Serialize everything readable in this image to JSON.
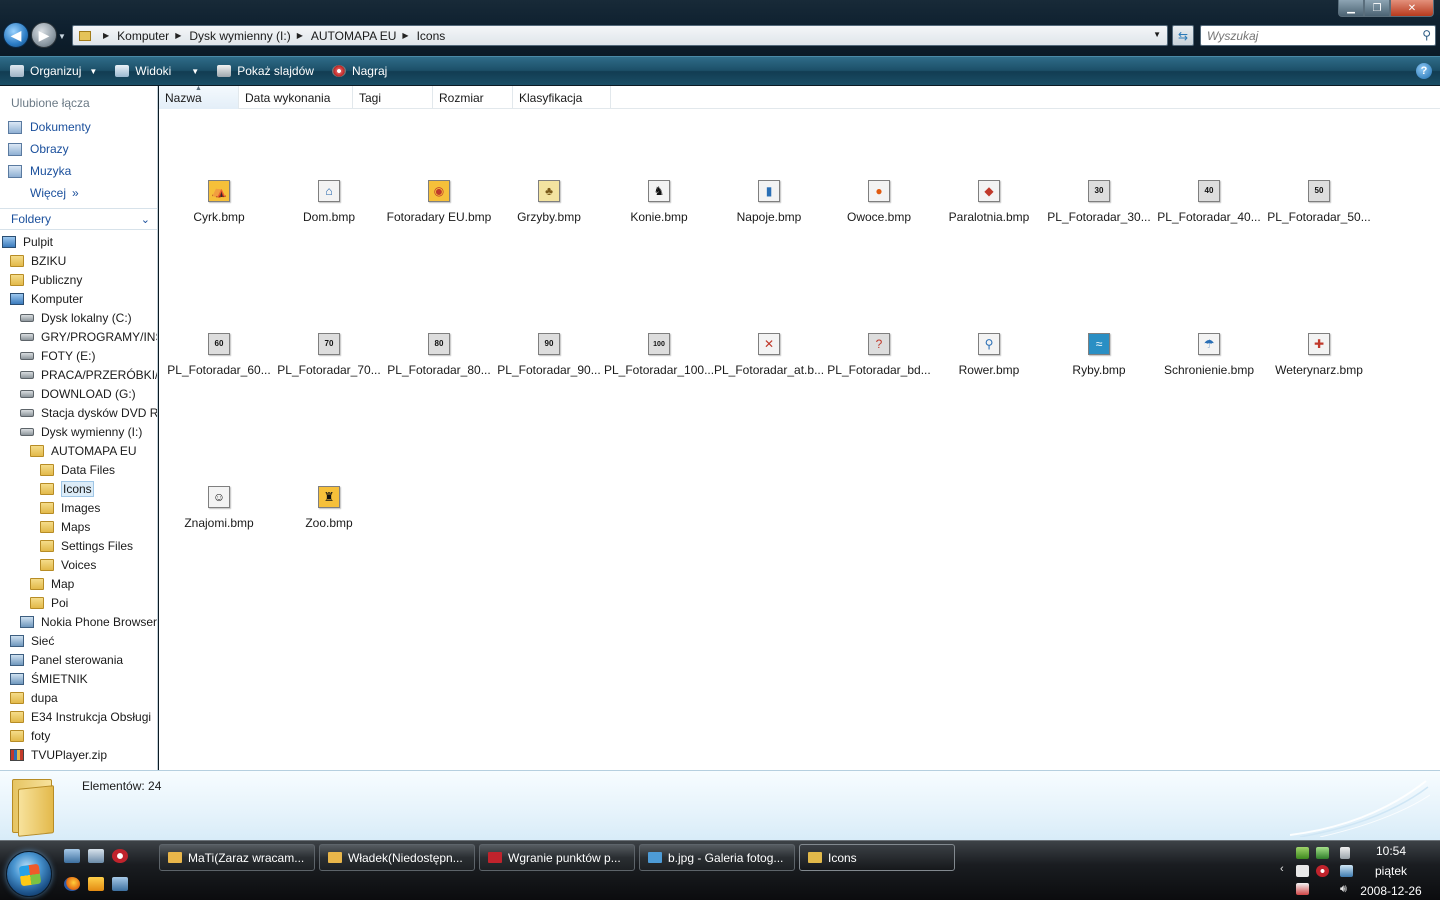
{
  "titlebar": {
    "breadcrumbs": [
      "Komputer",
      "Dysk wymienny (I:)",
      "AUTOMAPA EU",
      "Icons"
    ],
    "search_placeholder": "Wyszukaj"
  },
  "toolbar": {
    "organize": "Organizuj",
    "views": "Widoki",
    "slideshow": "Pokaż slajdów",
    "burn": "Nagraj"
  },
  "nav": {
    "favorites_title": "Ulubione łącza",
    "favorites": [
      "Dokumenty",
      "Obrazy",
      "Muzyka"
    ],
    "more": "Więcej",
    "folders_title": "Foldery",
    "tree": [
      {
        "label": "Pulpit",
        "level": 0,
        "icon": "desktop-icon"
      },
      {
        "label": "BZIKU",
        "level": 1,
        "icon": "folder-icon"
      },
      {
        "label": "Publiczny",
        "level": 1,
        "icon": "folder-icon"
      },
      {
        "label": "Komputer",
        "level": 1,
        "icon": "computer-icon"
      },
      {
        "label": "Dysk lokalny (C:)",
        "level": 2,
        "icon": "drive-icon"
      },
      {
        "label": "GRY/PROGRAMY/INS",
        "level": 2,
        "icon": "drive-icon"
      },
      {
        "label": "FOTY (E:)",
        "level": 2,
        "icon": "drive-icon"
      },
      {
        "label": "PRACA/PRZERÓBKI/B",
        "level": 2,
        "icon": "drive-icon"
      },
      {
        "label": "DOWNLOAD (G:)",
        "level": 2,
        "icon": "drive-icon"
      },
      {
        "label": "Stacja dysków DVD R\\",
        "level": 2,
        "icon": "dvd-drive-icon"
      },
      {
        "label": "Dysk wymienny (I:)",
        "level": 2,
        "icon": "removable-drive-icon"
      },
      {
        "label": "AUTOMAPA EU",
        "level": 3,
        "icon": "folder-icon"
      },
      {
        "label": "Data Files",
        "level": 4,
        "icon": "folder-icon"
      },
      {
        "label": "Icons",
        "level": 4,
        "icon": "folder-icon",
        "selected": true
      },
      {
        "label": "Images",
        "level": 4,
        "icon": "folder-icon"
      },
      {
        "label": "Maps",
        "level": 4,
        "icon": "folder-icon"
      },
      {
        "label": "Settings Files",
        "level": 4,
        "icon": "folder-icon"
      },
      {
        "label": "Voices",
        "level": 4,
        "icon": "folder-icon"
      },
      {
        "label": "Map",
        "level": 3,
        "icon": "folder-icon"
      },
      {
        "label": "Poi",
        "level": 3,
        "icon": "folder-icon"
      },
      {
        "label": "Nokia Phone Browser",
        "level": 2,
        "icon": "phone-icon"
      },
      {
        "label": "Sieć",
        "level": 1,
        "icon": "network-icon"
      },
      {
        "label": "Panel sterowania",
        "level": 1,
        "icon": "control-panel-icon"
      },
      {
        "label": "ŚMIETNIK",
        "level": 1,
        "icon": "recycle-bin-icon"
      },
      {
        "label": "dupa",
        "level": 1,
        "icon": "folder-icon"
      },
      {
        "label": "E34 Instrukcja Obsługi",
        "level": 1,
        "icon": "folder-icon"
      },
      {
        "label": "foty",
        "level": 1,
        "icon": "folder-icon"
      },
      {
        "label": "TVUPlayer.zip",
        "level": 1,
        "icon": "zip-icon"
      }
    ]
  },
  "columns": [
    "Nazwa",
    "Data wykonania",
    "Tagi",
    "Rozmiar",
    "Klasyfikacja"
  ],
  "files": [
    {
      "name": "Cyrk.bmp",
      "glyph": "⛺",
      "color": "#c0392b",
      "bg": "#f6c03a"
    },
    {
      "name": "Dom.bmp",
      "glyph": "⌂",
      "color": "#1b5fa8",
      "bg": "#f3f3f3"
    },
    {
      "name": "Fotoradary EU.bmp",
      "glyph": "◉",
      "color": "#c0392b",
      "bg": "#f6c03a"
    },
    {
      "name": "Grzyby.bmp",
      "glyph": "♣",
      "color": "#7a5a1a",
      "bg": "#f3e3a0"
    },
    {
      "name": "Konie.bmp",
      "glyph": "♞",
      "color": "#111111",
      "bg": "#f3f3f3"
    },
    {
      "name": "Napoje.bmp",
      "glyph": "▮",
      "color": "#2a6fb5",
      "bg": "#f3f3f3"
    },
    {
      "name": "Owoce.bmp",
      "glyph": "●",
      "color": "#e05a10",
      "bg": "#f3f3f3"
    },
    {
      "name": "Paralotnia.bmp",
      "glyph": "◆",
      "color": "#c0392b",
      "bg": "#f3f3f3"
    },
    {
      "name": "PL_Fotoradar_30...",
      "glyph": "30",
      "color": "#111111",
      "bg": "#dddddd"
    },
    {
      "name": "PL_Fotoradar_40...",
      "glyph": "40",
      "color": "#111111",
      "bg": "#dddddd"
    },
    {
      "name": "PL_Fotoradar_50...",
      "glyph": "50",
      "color": "#111111",
      "bg": "#dddddd"
    },
    {
      "name": "PL_Fotoradar_60...",
      "glyph": "60",
      "color": "#111111",
      "bg": "#dddddd"
    },
    {
      "name": "PL_Fotoradar_70...",
      "glyph": "70",
      "color": "#111111",
      "bg": "#dddddd"
    },
    {
      "name": "PL_Fotoradar_80...",
      "glyph": "80",
      "color": "#111111",
      "bg": "#dddddd"
    },
    {
      "name": "PL_Fotoradar_90...",
      "glyph": "90",
      "color": "#111111",
      "bg": "#dddddd"
    },
    {
      "name": "PL_Fotoradar_100...",
      "glyph": "100",
      "color": "#111111",
      "bg": "#dddddd"
    },
    {
      "name": "PL_Fotoradar_at.b...",
      "glyph": "✕",
      "color": "#c0392b",
      "bg": "#f3f3f3"
    },
    {
      "name": "PL_Fotoradar_bd...",
      "glyph": "?",
      "color": "#c0392b",
      "bg": "#dddddd"
    },
    {
      "name": "Rower.bmp",
      "glyph": "⚲",
      "color": "#2a6fb5",
      "bg": "#f3f3f3"
    },
    {
      "name": "Ryby.bmp",
      "glyph": "≈",
      "color": "#ffffff",
      "bg": "#2a8fc4"
    },
    {
      "name": "Schronienie.bmp",
      "glyph": "☂",
      "color": "#2a6fb5",
      "bg": "#f3f3f3"
    },
    {
      "name": "Weterynarz.bmp",
      "glyph": "✚",
      "color": "#c0392b",
      "bg": "#f3f3f3"
    },
    {
      "name": "Znajomi.bmp",
      "glyph": "☺",
      "color": "#111111",
      "bg": "#f3f3f3"
    },
    {
      "name": "Zoo.bmp",
      "glyph": "♜",
      "color": "#111111",
      "bg": "#f6c03a"
    }
  ],
  "details": {
    "count": "Elementów: 24"
  },
  "taskbar": {
    "tasks": [
      {
        "label": "MaTi(Zaraz wracam...",
        "icon": "envelope-icon",
        "color": "#e9b64a"
      },
      {
        "label": "Władek(Niedostępn...",
        "icon": "envelope-icon",
        "color": "#e9b64a"
      },
      {
        "label": "Wgranie punktów p...",
        "icon": "opera-icon",
        "color": "#c0232c"
      },
      {
        "label": "b.jpg - Galeria fotog...",
        "icon": "photo-gallery-icon",
        "color": "#4d9bd6"
      },
      {
        "label": "Icons",
        "icon": "folder-icon",
        "color": "#e2b94a",
        "active": true
      }
    ],
    "time": "10:54",
    "day": "piątek",
    "date": "2008-12-26"
  }
}
